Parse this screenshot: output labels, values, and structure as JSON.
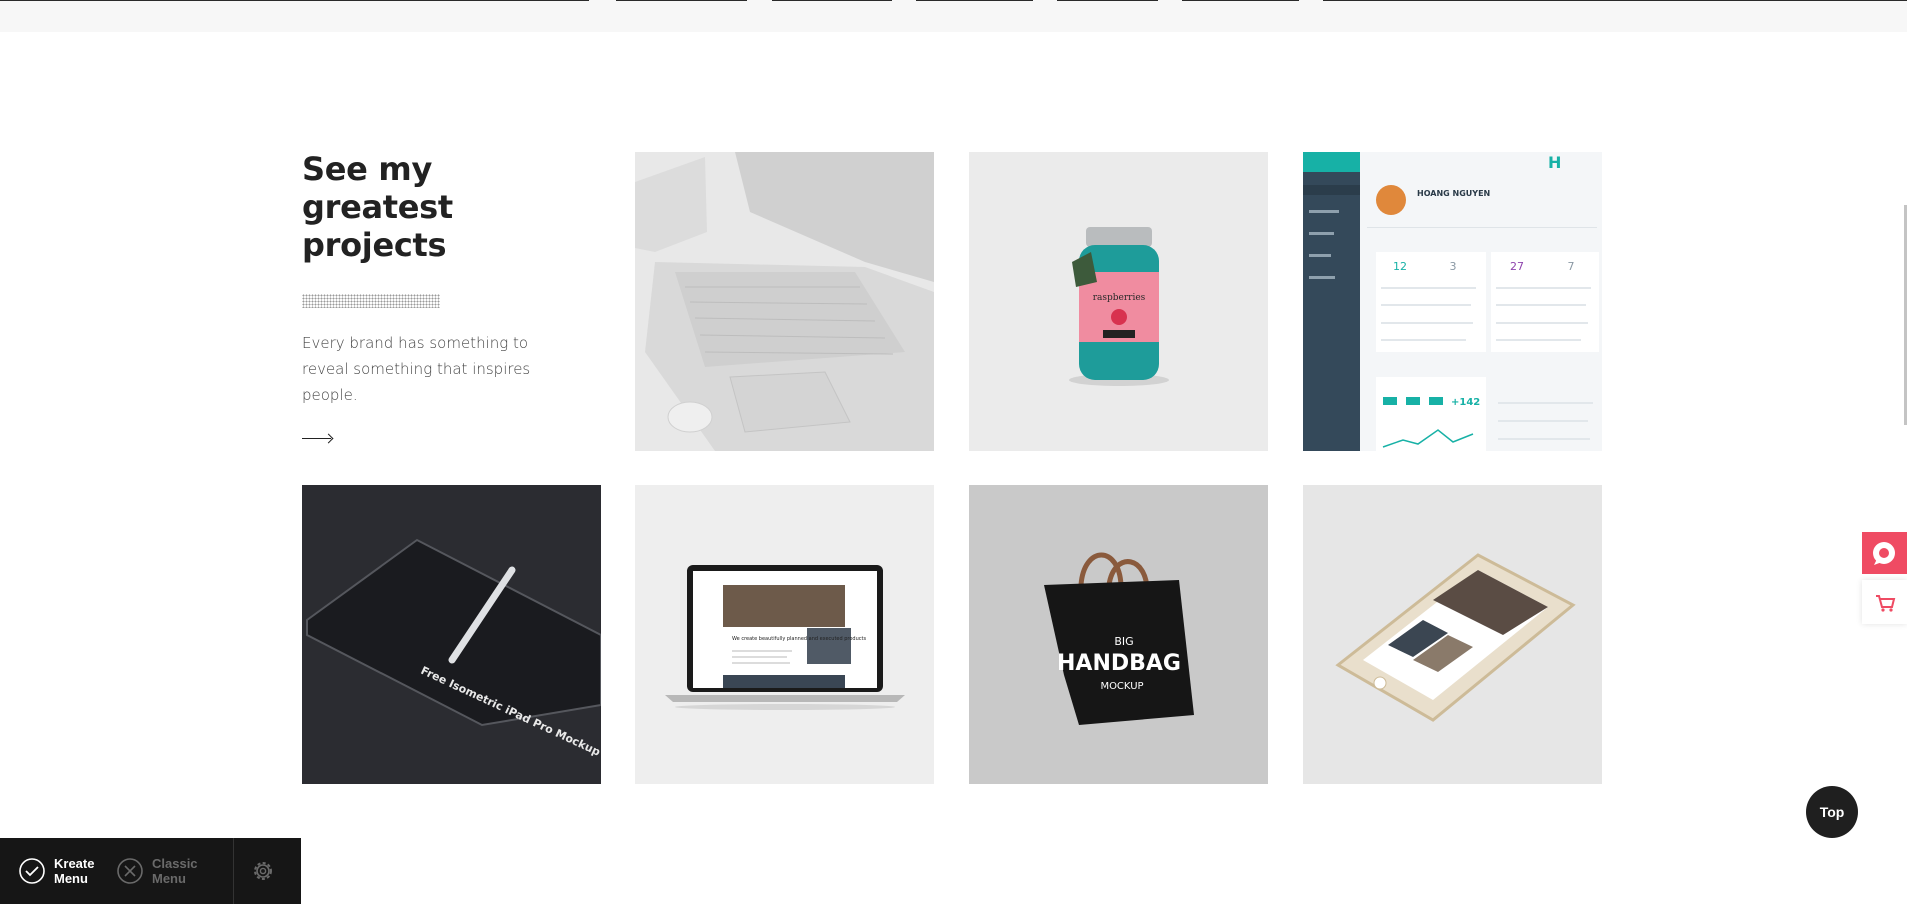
{
  "section": {
    "heading": "See my greatest projects",
    "description": "Every brand has something to reveal something that inspires people.",
    "more_icon": "arrow-right-icon"
  },
  "projects": [
    {
      "name": "laptop-mockup"
    },
    {
      "name": "raspberries-jar-mockup",
      "label": "raspberries"
    },
    {
      "name": "dashboard-ui",
      "user": "HOANG NGUYEN",
      "stats": [
        "12",
        "3",
        "27",
        "7",
        "+142"
      ]
    },
    {
      "name": "ipad-pro-mockup",
      "label": "Free Isometric iPad Pro Mockup"
    },
    {
      "name": "macbook-website-mockup",
      "label": "We create beautifully planned and executed products"
    },
    {
      "name": "handbag-mockup",
      "label_top": "BIG",
      "label_main": "HANDBAG",
      "label_bottom": "MOCKUP"
    },
    {
      "name": "iphone-mockup"
    }
  ],
  "side_widgets": {
    "chat_icon": "chat-bubble-icon",
    "cart_icon": "shopping-cart-icon",
    "accent": "#ef4b63"
  },
  "top_button": {
    "label": "Top"
  },
  "menu_switcher": {
    "kreate_label": "Kreate Menu",
    "classic_label": "Classic Menu",
    "settings_icon": "gear-icon"
  }
}
